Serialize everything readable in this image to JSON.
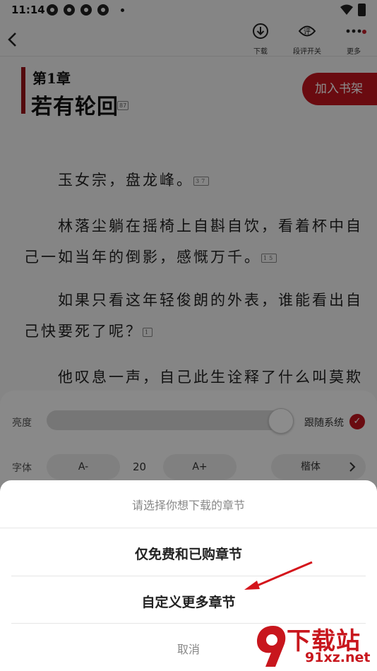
{
  "status_bar": {
    "time": "11:14"
  },
  "toolbar": {
    "back_icon": "chevron-left-icon",
    "download_label": "下载",
    "review_label": "段评开关",
    "more_label": "更多"
  },
  "chapter": {
    "number": "第1章",
    "title": "若有轮回",
    "title_comment_count": "87"
  },
  "add_to_shelf": "加入书架",
  "paragraphs": [
    {
      "text": "　　玉女宗，盘龙峰。",
      "comment_count": "37"
    },
    {
      "text": "　　林落尘躺在摇椅上自斟自饮，看着杯中自己一如当年的倒影，感慨万千。",
      "comment_count": "15"
    },
    {
      "text": "　　如果只看这年轻俊朗的外表，谁能看出自己快要死了呢？",
      "comment_count": "1"
    },
    {
      "text": "　　他叹息一声，自己此生诠释了什么叫莫欺",
      "comment_count": ""
    }
  ],
  "settings": {
    "brightness_label": "亮度",
    "brightness_level": 0.9,
    "follow_system_label": "跟随系统",
    "font_label": "字体",
    "decrease_label": "A-",
    "font_size": "20",
    "increase_label": "A+",
    "typeface": "楷体"
  },
  "download_sheet": {
    "prompt": "请选择你想下载的章节",
    "options": [
      "仅免费和已购章节",
      "自定义更多章节"
    ],
    "cancel": "取消"
  },
  "watermark": {
    "text": "下载站",
    "url": "91xz.net"
  },
  "colors": {
    "accent": "#c2141e",
    "chapter_bar": "#9a1118"
  }
}
